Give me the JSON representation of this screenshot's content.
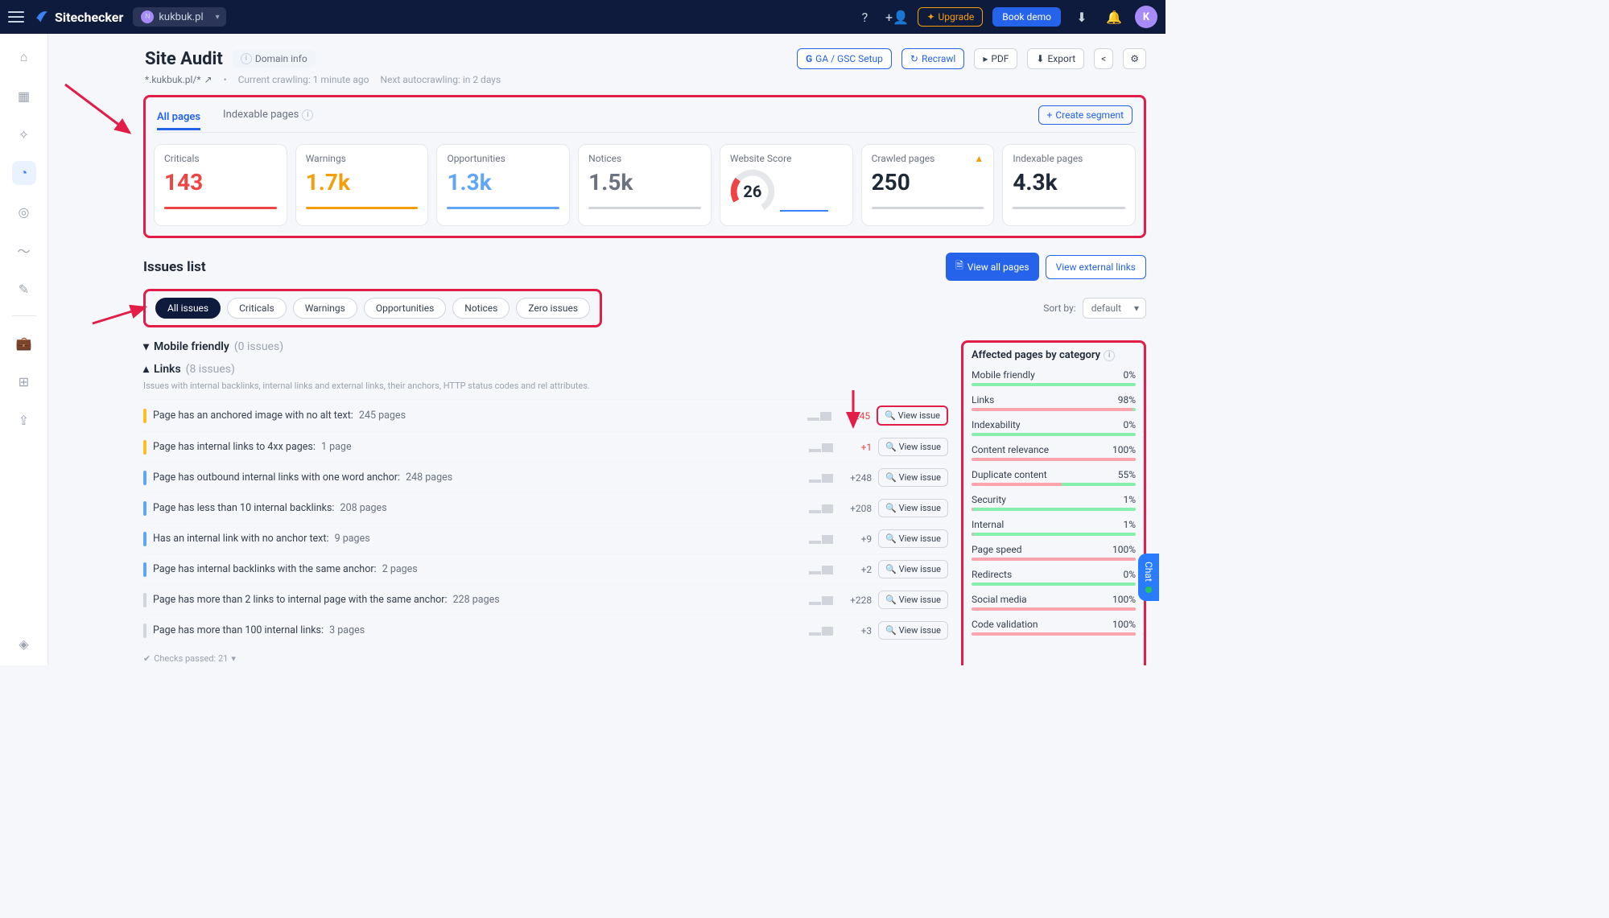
{
  "topbar": {
    "brand": "Sitechecker",
    "domain_badge": "N",
    "domain": "kukbuk.pl",
    "upgrade": "Upgrade",
    "book_demo": "Book demo",
    "avatar_letter": "K"
  },
  "header": {
    "title": "Site Audit",
    "domain_info_btn": "Domain info",
    "scope": "*.kukbuk.pl/*",
    "crawl_now": "Current crawling: 1 minute ago",
    "crawl_next": "Next autocrawling: in 2 days",
    "gsc": "GA / GSC Setup",
    "recrawl": "Recrawl",
    "pdf": "PDF",
    "export": "Export"
  },
  "tabs": {
    "all_pages": "All pages",
    "indexable": "Indexable pages",
    "create_segment": "Create segment"
  },
  "stats": {
    "criticals_label": "Criticals",
    "criticals_value": "143",
    "warnings_label": "Warnings",
    "warnings_value": "1.7k",
    "opportunities_label": "Opportunities",
    "opportunities_value": "1.3k",
    "notices_label": "Notices",
    "notices_value": "1.5k",
    "score_label": "Website Score",
    "score_value": "26",
    "crawled_label": "Crawled pages",
    "crawled_value": "250",
    "indexable_label": "Indexable pages",
    "indexable_value": "4.3k"
  },
  "issues": {
    "title": "Issues list",
    "view_all_pages": "View all pages",
    "view_external": "View external links",
    "filters": {
      "all": "All issues",
      "criticals": "Criticals",
      "warnings": "Warnings",
      "opportunities": "Opportunities",
      "notices": "Notices",
      "zero": "Zero issues"
    },
    "sort_label": "Sort by:",
    "sort_value": "default"
  },
  "groups": {
    "mobile": {
      "name": "Mobile friendly",
      "count": "(0 issues)"
    },
    "links": {
      "name": "Links",
      "count": "(8 issues)",
      "desc": "Issues with internal backlinks, internal links and external links, their anchors, HTTP status codes and rel attributes."
    }
  },
  "link_issues": [
    {
      "t": "Page has an anchored image with no alt text:",
      "c": "245 pages",
      "d": "+245",
      "sev": "warn",
      "dcls": "pos"
    },
    {
      "t": "Page has internal links to 4xx pages:",
      "c": "1 page",
      "d": "+1",
      "sev": "warn",
      "dcls": "pos"
    },
    {
      "t": "Page has outbound internal links with one word anchor:",
      "c": "248 pages",
      "d": "+248",
      "sev": "opp",
      "dcls": "gray"
    },
    {
      "t": "Page has less than 10 internal backlinks:",
      "c": "208 pages",
      "d": "+208",
      "sev": "opp",
      "dcls": "gray"
    },
    {
      "t": "Has an internal link with no anchor text:",
      "c": "9 pages",
      "d": "+9",
      "sev": "opp",
      "dcls": "gray"
    },
    {
      "t": "Page has internal backlinks with the same anchor:",
      "c": "2 pages",
      "d": "+2",
      "sev": "opp",
      "dcls": "gray"
    },
    {
      "t": "Page has more than 2 links to internal page with the same anchor:",
      "c": "228 pages",
      "d": "+228",
      "sev": "note",
      "dcls": "gray"
    },
    {
      "t": "Page has more than 100 internal links:",
      "c": "3 pages",
      "d": "+3",
      "sev": "note",
      "dcls": "gray"
    }
  ],
  "view_issue_label": "View issue",
  "checks_passed": "Checks passed: 21",
  "categories": {
    "title": "Affected pages by category",
    "items": [
      {
        "name": "Mobile friendly",
        "pct": "0%",
        "bad": 0
      },
      {
        "name": "Links",
        "pct": "98%",
        "bad": 98
      },
      {
        "name": "Indexability",
        "pct": "0%",
        "bad": 0
      },
      {
        "name": "Content relevance",
        "pct": "100%",
        "bad": 100
      },
      {
        "name": "Duplicate content",
        "pct": "55%",
        "bad": 55
      },
      {
        "name": "Security",
        "pct": "1%",
        "bad": 1
      },
      {
        "name": "Internal",
        "pct": "1%",
        "bad": 1
      },
      {
        "name": "Page speed",
        "pct": "100%",
        "bad": 100
      },
      {
        "name": "Redirects",
        "pct": "0%",
        "bad": 0
      },
      {
        "name": "Social media",
        "pct": "100%",
        "bad": 100
      },
      {
        "name": "Code validation",
        "pct": "100%",
        "bad": 100
      }
    ]
  },
  "chat_label": "Chat"
}
